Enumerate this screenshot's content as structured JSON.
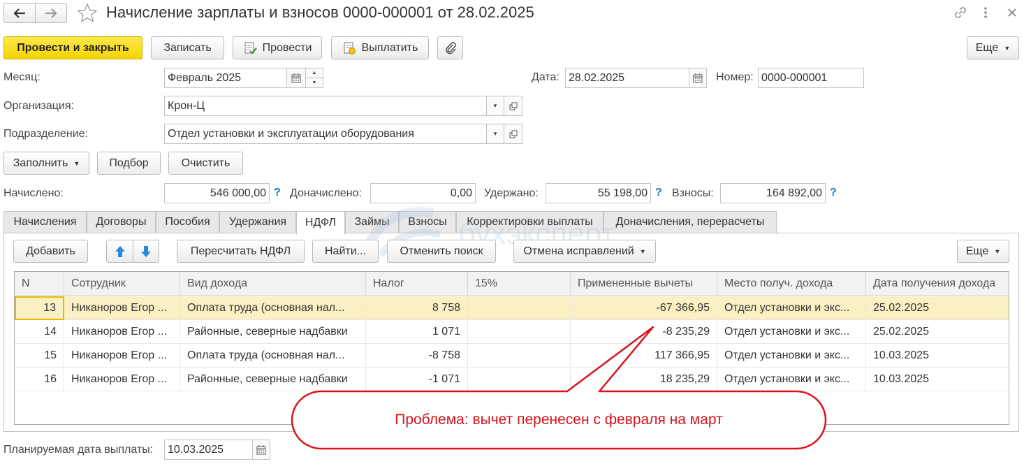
{
  "window": {
    "title": "Начисление зарплаты и взносов 0000-000001 от 28.02.2025"
  },
  "toolbar": {
    "post_close": "Провести и закрыть",
    "save": "Записать",
    "post": "Провести",
    "pay": "Выплатить",
    "more": "Еще"
  },
  "form": {
    "month_label": "Месяц:",
    "month_value": "Февраль 2025",
    "date_label": "Дата:",
    "date_value": "28.02.2025",
    "number_label": "Номер:",
    "number_value": "0000-000001",
    "org_label": "Организация:",
    "org_value": "Крон-Ц",
    "dept_label": "Подразделение:",
    "dept_value": "Отдел установки и эксплуатации оборудования"
  },
  "actions": {
    "fill": "Заполнить",
    "select": "Подбор",
    "clear": "Очистить"
  },
  "totals": {
    "accrued_label": "Начислено:",
    "accrued_value": "546 000,00",
    "additional_label": "Доначислено:",
    "additional_value": "0,00",
    "withheld_label": "Удержано:",
    "withheld_value": "55 198,00",
    "contrib_label": "Взносы:",
    "contrib_value": "164 892,00",
    "help_mark": "?"
  },
  "tabs": [
    {
      "label": "Начисления"
    },
    {
      "label": "Договоры"
    },
    {
      "label": "Пособия"
    },
    {
      "label": "Удержания"
    },
    {
      "label": "НДФЛ"
    },
    {
      "label": "Займы"
    },
    {
      "label": "Взносы"
    },
    {
      "label": "Корректировки выплаты"
    },
    {
      "label": "Доначисления, перерасчеты"
    }
  ],
  "tab_toolbar": {
    "add": "Добавить",
    "recalc": "Пересчитать НДФЛ",
    "find": "Найти...",
    "cancel_search": "Отменить поиск",
    "cancel_corrections": "Отмена исправлений",
    "more": "Еще"
  },
  "watermark": "бухэксперт",
  "table": {
    "columns": [
      "N",
      "Сотрудник",
      "Вид дохода",
      "Налог",
      "15%",
      "Примененные вычеты",
      "Место получ. дохода",
      "Дата получения дохода"
    ],
    "rows": [
      {
        "n": "13",
        "employee": "Никаноров Егор ...",
        "income": "Оплата труда (основная нал...",
        "tax": "8 758",
        "p15": "",
        "deductions": "-67 366,95",
        "place": "Отдел установки и экс...",
        "date": "25.02.2025"
      },
      {
        "n": "14",
        "employee": "Никаноров Егор ...",
        "income": "Районные, северные надбавки",
        "tax": "1 071",
        "p15": "",
        "deductions": "-8 235,29",
        "place": "Отдел установки и экс...",
        "date": "25.02.2025"
      },
      {
        "n": "15",
        "employee": "Никаноров Егор ...",
        "income": "Оплата труда (основная нал...",
        "tax": "-8 758",
        "p15": "",
        "deductions": "117 366,95",
        "place": "Отдел установки и экс...",
        "date": "10.03.2025"
      },
      {
        "n": "16",
        "employee": "Никаноров Егор ...",
        "income": "Районные, северные надбавки",
        "tax": "-1 071",
        "p15": "",
        "deductions": "18 235,29",
        "place": "Отдел установки и экс...",
        "date": "10.03.2025"
      }
    ]
  },
  "footer": {
    "pay_date_label": "Планируемая дата выплаты:",
    "pay_date_value": "10.03.2025"
  },
  "callout": {
    "text": "Проблема: вычет перенесен с февраля на март"
  }
}
